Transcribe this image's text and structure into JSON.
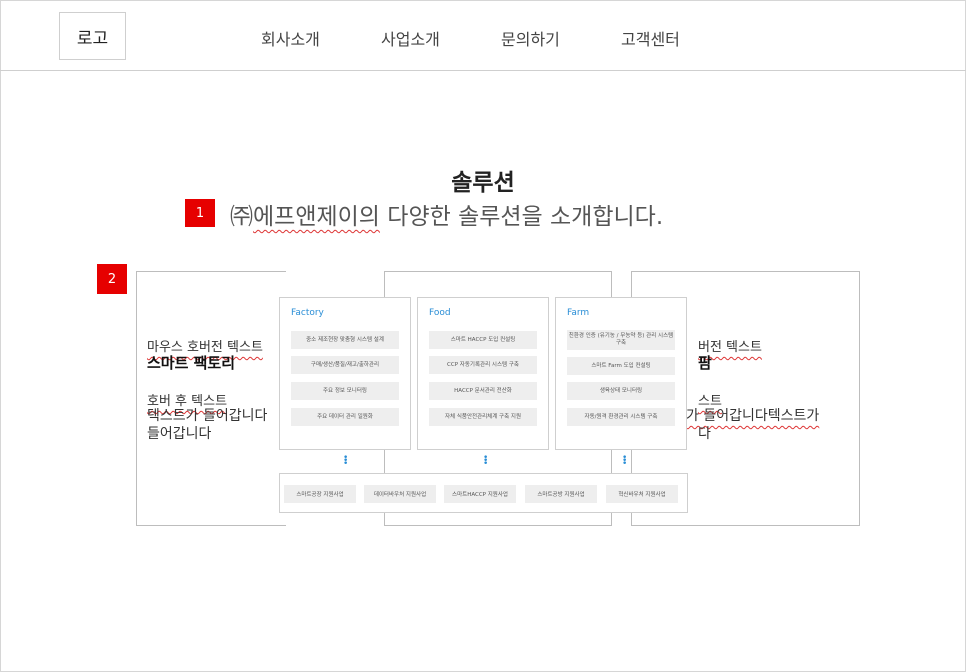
{
  "header": {
    "logo": "로고",
    "nav": [
      "회사소개",
      "사업소개",
      "문의하기",
      "고객센터"
    ]
  },
  "section": {
    "title": "솔루션",
    "subtitle_prefix": "㈜",
    "subtitle_company": "에프앤제이의",
    "subtitle_rest": " 다양한 솔루션을 소개합니다."
  },
  "markers": [
    "1",
    "2"
  ],
  "cards": {
    "left": {
      "hover_title": "마우스 호버전 텍스트",
      "main_title": "스마트 팩토리",
      "after_title": "호버 후 텍스트",
      "body_line1": "텍스트가 들어갑니다",
      "body_line2": "들어갑니다"
    },
    "right": {
      "hover_title": "버전 텍스트",
      "main_title": "팜",
      "after_title": "스트",
      "body_line1": "가 들어갑니다텍스트가",
      "body_line2": "다"
    }
  },
  "diagram": {
    "columns": [
      {
        "name": "Factory",
        "items": [
          "중소 제조현장 맞춤형 시스템 설계",
          "구매/생산/품질/재고/출하관리",
          "주요 정보 모니터링",
          "주요 데이터 관리 일원화"
        ]
      },
      {
        "name": "Food",
        "items": [
          "스마트 HACCP 도입 컨설팅",
          "CCP 자동기록관리 시스템 구축",
          "HACCP 문서관리 전산화",
          "자체 식품안전관리체계 구축 지원"
        ]
      },
      {
        "name": "Farm",
        "items": [
          "친환경 인증 (유기농 / 무농약 등) 관리 시스템 구축",
          "스마트 Farm 도입 컨설팅",
          "생육상태 모니터링",
          "자동/원격 환경관리 시스템 구축"
        ]
      }
    ],
    "programs": [
      "스마트공장 지원사업",
      "데이터바우처 지원사업",
      "스마트HACCP 지원사업",
      "스마트공방 지원사업",
      "혁신바우처 지원사업"
    ]
  },
  "colors": {
    "accent": "#2a8ed6",
    "marker": "#e60000"
  }
}
